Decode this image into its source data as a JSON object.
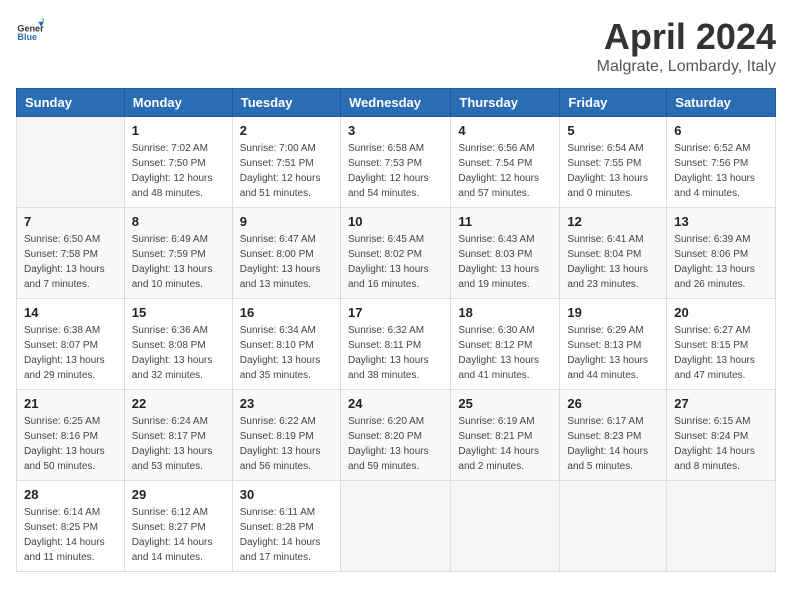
{
  "header": {
    "logo_general": "General",
    "logo_blue": "Blue",
    "title": "April 2024",
    "location": "Malgrate, Lombardy, Italy"
  },
  "weekdays": [
    "Sunday",
    "Monday",
    "Tuesday",
    "Wednesday",
    "Thursday",
    "Friday",
    "Saturday"
  ],
  "weeks": [
    [
      {
        "day": "",
        "info": ""
      },
      {
        "day": "1",
        "info": "Sunrise: 7:02 AM\nSunset: 7:50 PM\nDaylight: 12 hours\nand 48 minutes."
      },
      {
        "day": "2",
        "info": "Sunrise: 7:00 AM\nSunset: 7:51 PM\nDaylight: 12 hours\nand 51 minutes."
      },
      {
        "day": "3",
        "info": "Sunrise: 6:58 AM\nSunset: 7:53 PM\nDaylight: 12 hours\nand 54 minutes."
      },
      {
        "day": "4",
        "info": "Sunrise: 6:56 AM\nSunset: 7:54 PM\nDaylight: 12 hours\nand 57 minutes."
      },
      {
        "day": "5",
        "info": "Sunrise: 6:54 AM\nSunset: 7:55 PM\nDaylight: 13 hours\nand 0 minutes."
      },
      {
        "day": "6",
        "info": "Sunrise: 6:52 AM\nSunset: 7:56 PM\nDaylight: 13 hours\nand 4 minutes."
      }
    ],
    [
      {
        "day": "7",
        "info": "Sunrise: 6:50 AM\nSunset: 7:58 PM\nDaylight: 13 hours\nand 7 minutes."
      },
      {
        "day": "8",
        "info": "Sunrise: 6:49 AM\nSunset: 7:59 PM\nDaylight: 13 hours\nand 10 minutes."
      },
      {
        "day": "9",
        "info": "Sunrise: 6:47 AM\nSunset: 8:00 PM\nDaylight: 13 hours\nand 13 minutes."
      },
      {
        "day": "10",
        "info": "Sunrise: 6:45 AM\nSunset: 8:02 PM\nDaylight: 13 hours\nand 16 minutes."
      },
      {
        "day": "11",
        "info": "Sunrise: 6:43 AM\nSunset: 8:03 PM\nDaylight: 13 hours\nand 19 minutes."
      },
      {
        "day": "12",
        "info": "Sunrise: 6:41 AM\nSunset: 8:04 PM\nDaylight: 13 hours\nand 23 minutes."
      },
      {
        "day": "13",
        "info": "Sunrise: 6:39 AM\nSunset: 8:06 PM\nDaylight: 13 hours\nand 26 minutes."
      }
    ],
    [
      {
        "day": "14",
        "info": "Sunrise: 6:38 AM\nSunset: 8:07 PM\nDaylight: 13 hours\nand 29 minutes."
      },
      {
        "day": "15",
        "info": "Sunrise: 6:36 AM\nSunset: 8:08 PM\nDaylight: 13 hours\nand 32 minutes."
      },
      {
        "day": "16",
        "info": "Sunrise: 6:34 AM\nSunset: 8:10 PM\nDaylight: 13 hours\nand 35 minutes."
      },
      {
        "day": "17",
        "info": "Sunrise: 6:32 AM\nSunset: 8:11 PM\nDaylight: 13 hours\nand 38 minutes."
      },
      {
        "day": "18",
        "info": "Sunrise: 6:30 AM\nSunset: 8:12 PM\nDaylight: 13 hours\nand 41 minutes."
      },
      {
        "day": "19",
        "info": "Sunrise: 6:29 AM\nSunset: 8:13 PM\nDaylight: 13 hours\nand 44 minutes."
      },
      {
        "day": "20",
        "info": "Sunrise: 6:27 AM\nSunset: 8:15 PM\nDaylight: 13 hours\nand 47 minutes."
      }
    ],
    [
      {
        "day": "21",
        "info": "Sunrise: 6:25 AM\nSunset: 8:16 PM\nDaylight: 13 hours\nand 50 minutes."
      },
      {
        "day": "22",
        "info": "Sunrise: 6:24 AM\nSunset: 8:17 PM\nDaylight: 13 hours\nand 53 minutes."
      },
      {
        "day": "23",
        "info": "Sunrise: 6:22 AM\nSunset: 8:19 PM\nDaylight: 13 hours\nand 56 minutes."
      },
      {
        "day": "24",
        "info": "Sunrise: 6:20 AM\nSunset: 8:20 PM\nDaylight: 13 hours\nand 59 minutes."
      },
      {
        "day": "25",
        "info": "Sunrise: 6:19 AM\nSunset: 8:21 PM\nDaylight: 14 hours\nand 2 minutes."
      },
      {
        "day": "26",
        "info": "Sunrise: 6:17 AM\nSunset: 8:23 PM\nDaylight: 14 hours\nand 5 minutes."
      },
      {
        "day": "27",
        "info": "Sunrise: 6:15 AM\nSunset: 8:24 PM\nDaylight: 14 hours\nand 8 minutes."
      }
    ],
    [
      {
        "day": "28",
        "info": "Sunrise: 6:14 AM\nSunset: 8:25 PM\nDaylight: 14 hours\nand 11 minutes."
      },
      {
        "day": "29",
        "info": "Sunrise: 6:12 AM\nSunset: 8:27 PM\nDaylight: 14 hours\nand 14 minutes."
      },
      {
        "day": "30",
        "info": "Sunrise: 6:11 AM\nSunset: 8:28 PM\nDaylight: 14 hours\nand 17 minutes."
      },
      {
        "day": "",
        "info": ""
      },
      {
        "day": "",
        "info": ""
      },
      {
        "day": "",
        "info": ""
      },
      {
        "day": "",
        "info": ""
      }
    ]
  ]
}
